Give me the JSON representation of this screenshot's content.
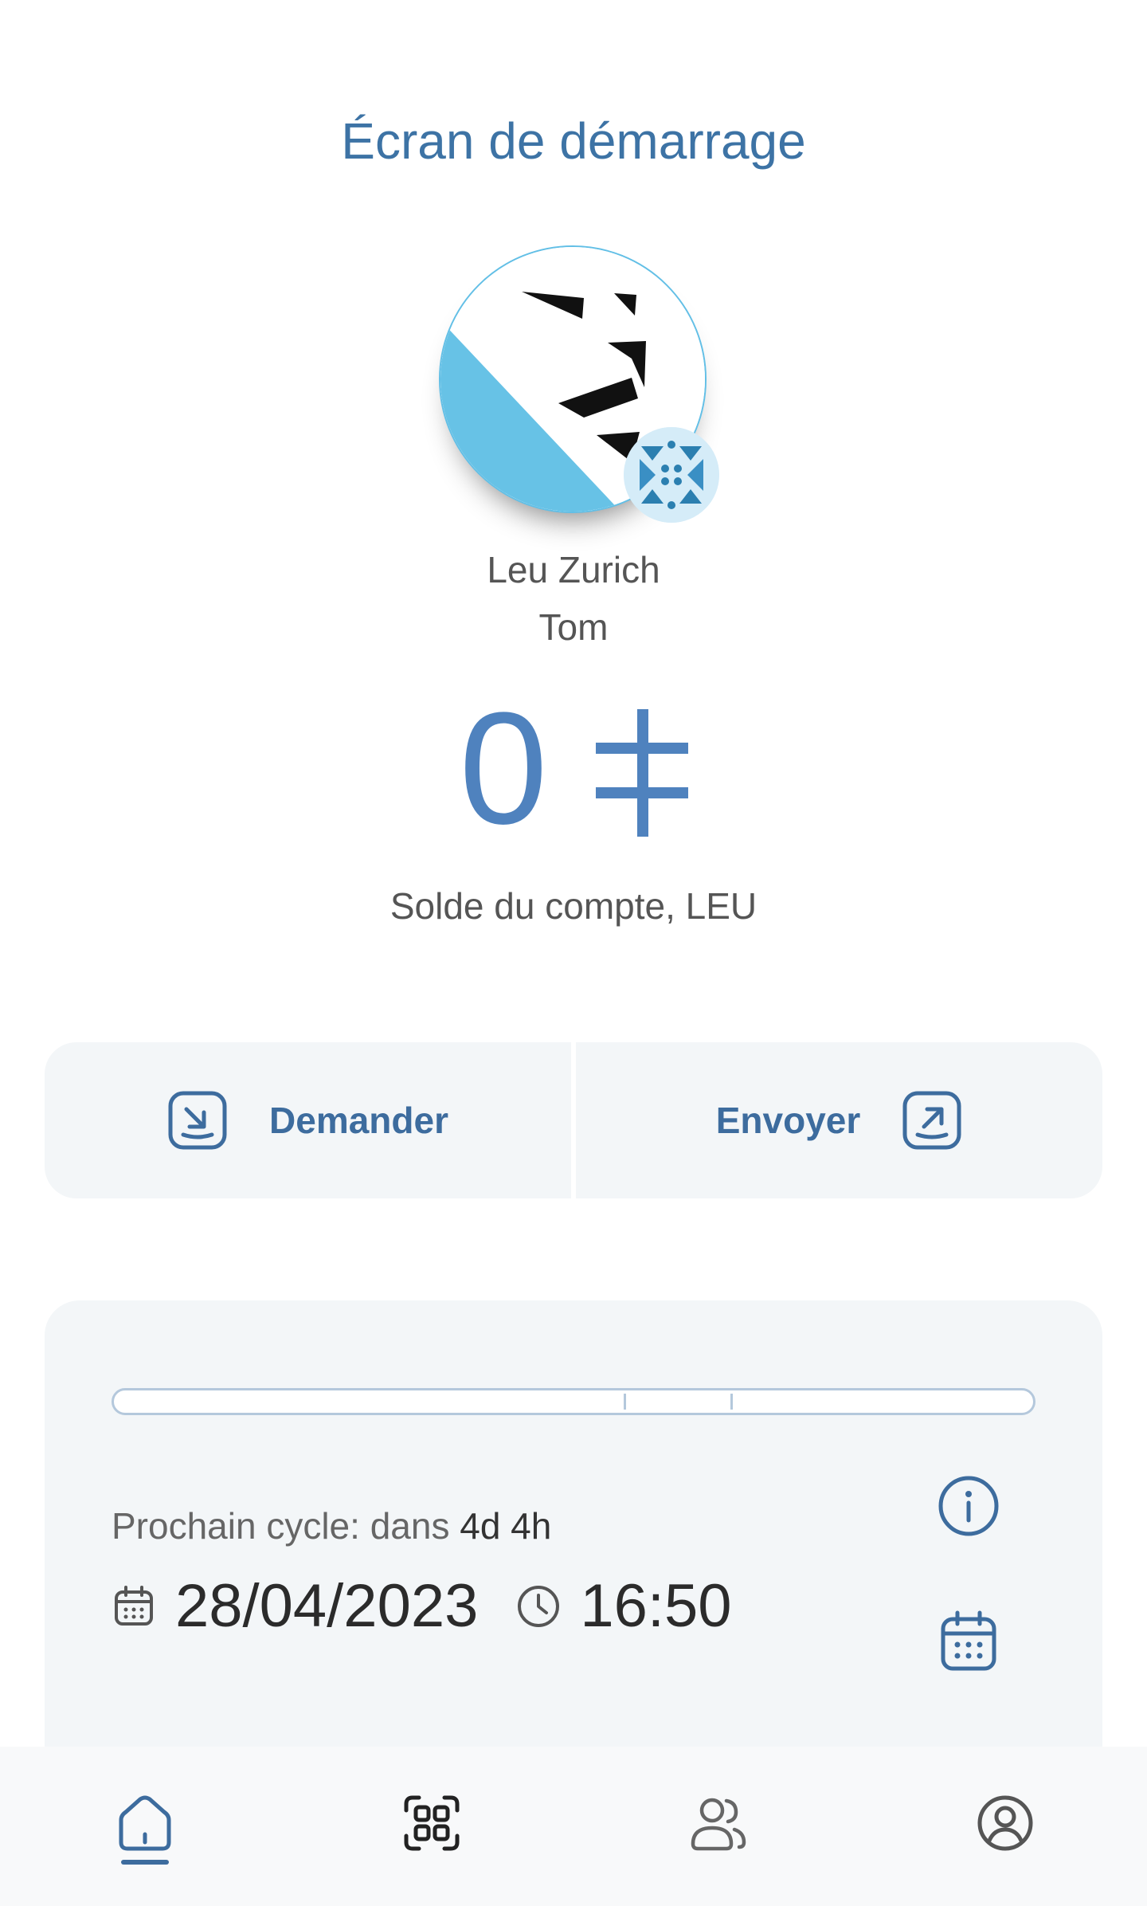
{
  "header": {
    "title": "Écran de démarrage"
  },
  "user": {
    "community": "Leu Zurich",
    "name": "Tom"
  },
  "balance": {
    "value": "0",
    "label": "Solde du compte, LEU"
  },
  "actions": {
    "request_label": "Demander",
    "send_label": "Envoyer"
  },
  "cycle": {
    "progress": 0,
    "label_prefix": "Prochain cycle: dans",
    "remaining": "4d 4h",
    "date": "28/04/2023",
    "time": "16:50"
  },
  "nav": {
    "items": [
      "home",
      "scan",
      "contacts",
      "profile"
    ],
    "active": "home"
  },
  "colors": {
    "accent": "#3d73a5",
    "brand_blue": "#4f82be",
    "zurich_blue": "#67c2e6",
    "card_bg": "#f3f6f8"
  },
  "icons": [
    "receive-icon",
    "send-icon",
    "info-icon",
    "calendar-icon",
    "clock-icon",
    "currency-icon",
    "home-icon",
    "qr-scan-icon",
    "contacts-icon",
    "profile-icon"
  ]
}
